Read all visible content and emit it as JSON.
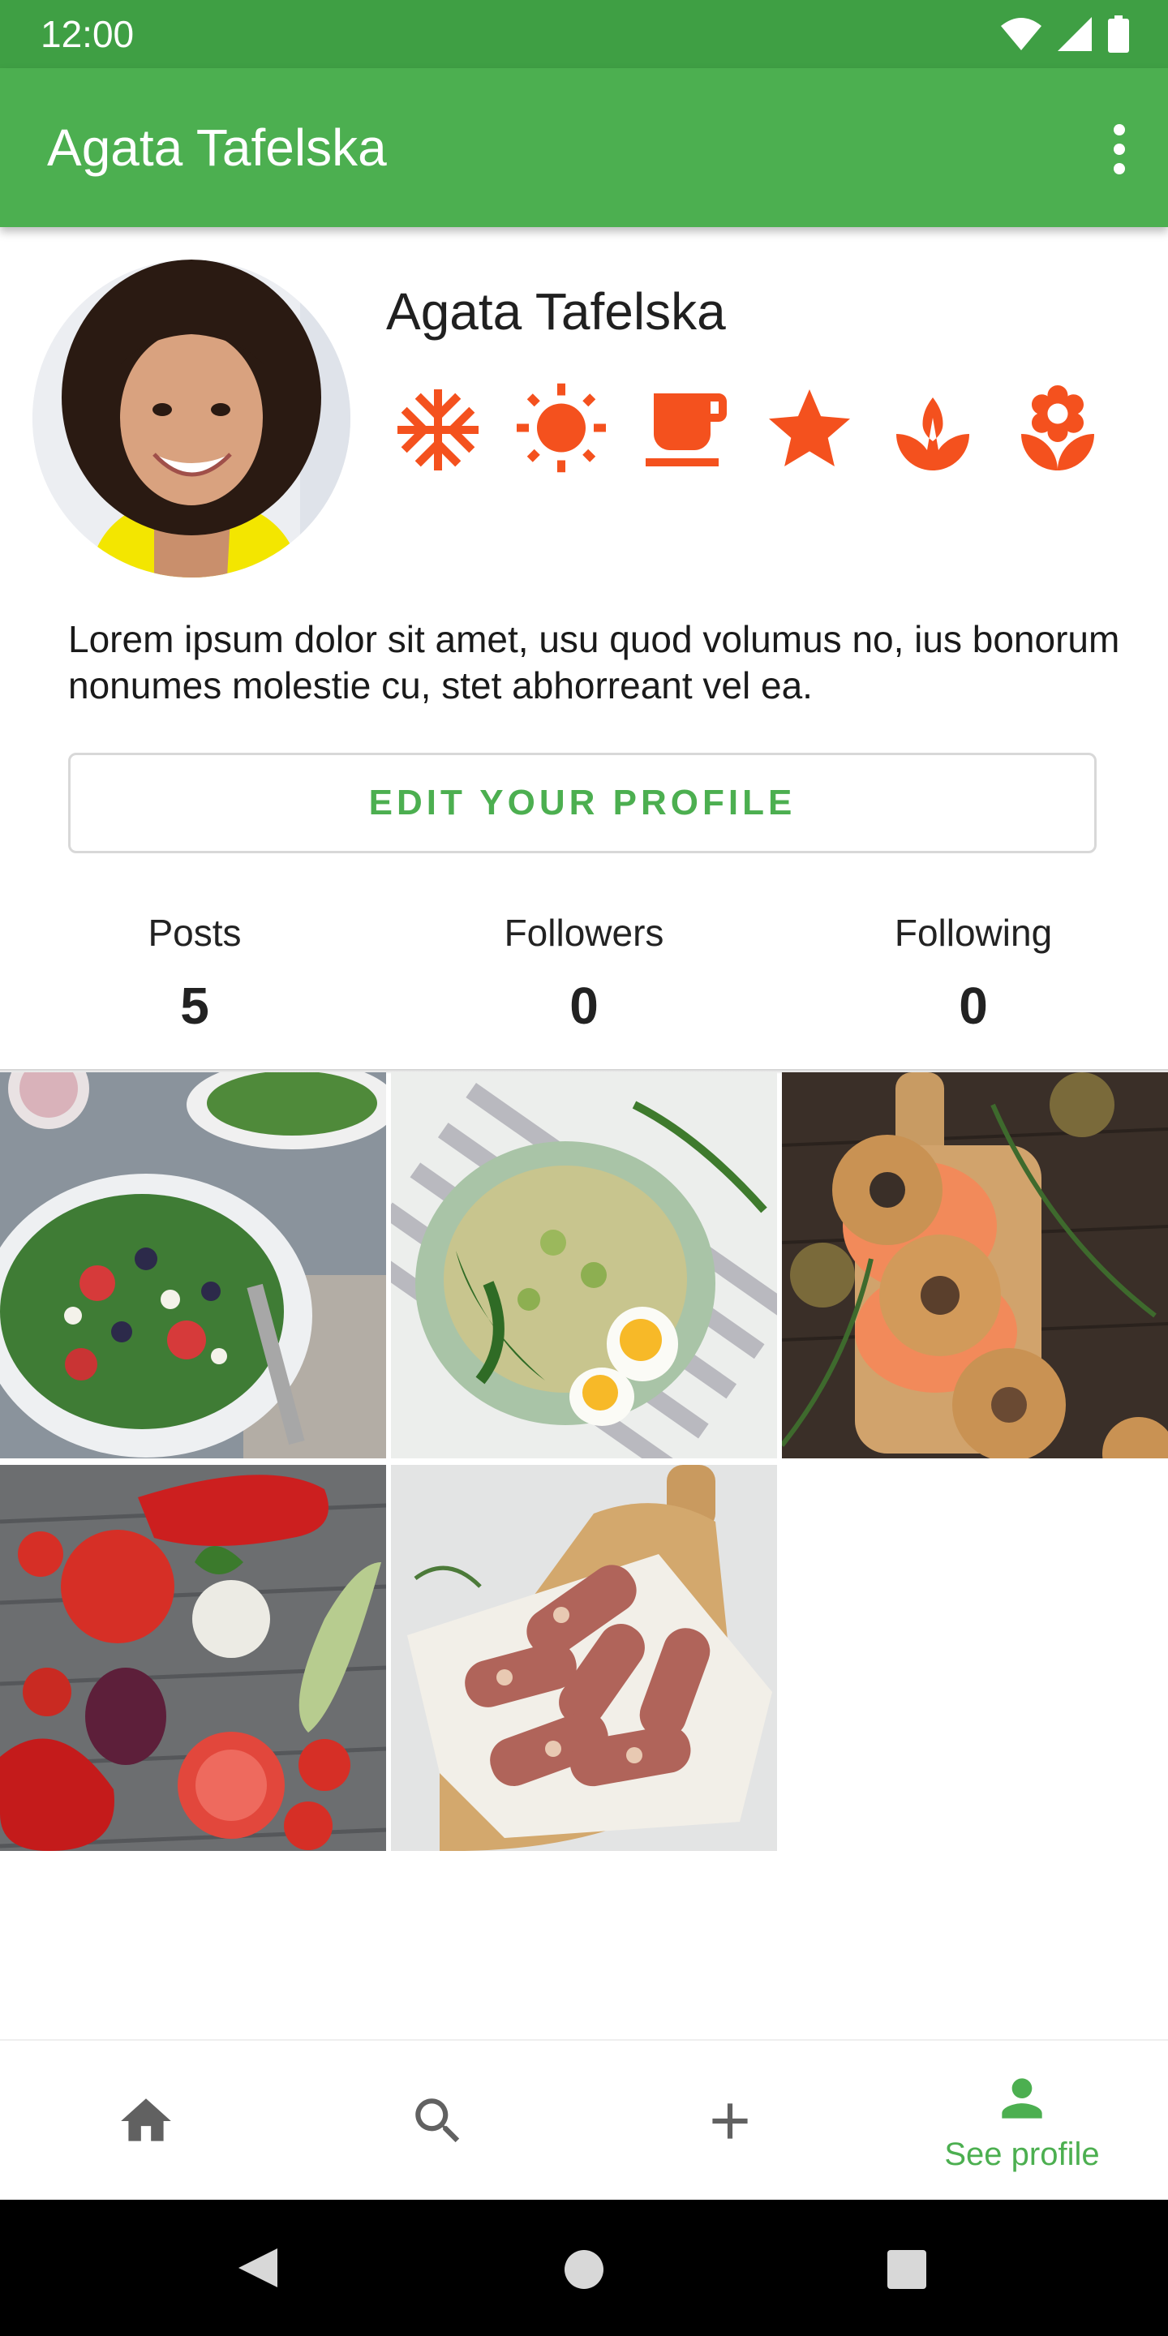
{
  "status_bar": {
    "time": "12:00"
  },
  "app_bar": {
    "title": "Agata Tafelska"
  },
  "profile": {
    "name": "Agata Tafelska",
    "bio": "Lorem ipsum dolor sit amet, usu quod volumus no, ius bonorum nonumes molestie cu, stet abhorreant vel ea.",
    "badges": [
      "snowflake-icon",
      "sun-icon",
      "coffee-icon",
      "star-icon",
      "tulip-icon",
      "flower-icon"
    ],
    "edit_button": "EDIT YOUR PROFILE"
  },
  "stats": [
    {
      "label": "Posts",
      "value": "5"
    },
    {
      "label": "Followers",
      "value": "0"
    },
    {
      "label": "Following",
      "value": "0"
    }
  ],
  "posts": [
    "salad",
    "rice-bowl-with-egg",
    "bagels-with-salmon",
    "vegetables",
    "bacon-rolls"
  ],
  "bottom_nav": {
    "items": [
      {
        "icon": "home-icon",
        "label": ""
      },
      {
        "icon": "search-icon",
        "label": ""
      },
      {
        "icon": "add-icon",
        "label": ""
      },
      {
        "icon": "person-icon",
        "label": "See profile",
        "active": true
      }
    ]
  },
  "colors": {
    "primary": "#4caf50",
    "status_bar": "#3f9f44",
    "accent": "#f4511e",
    "inactive_icon": "#616161"
  }
}
